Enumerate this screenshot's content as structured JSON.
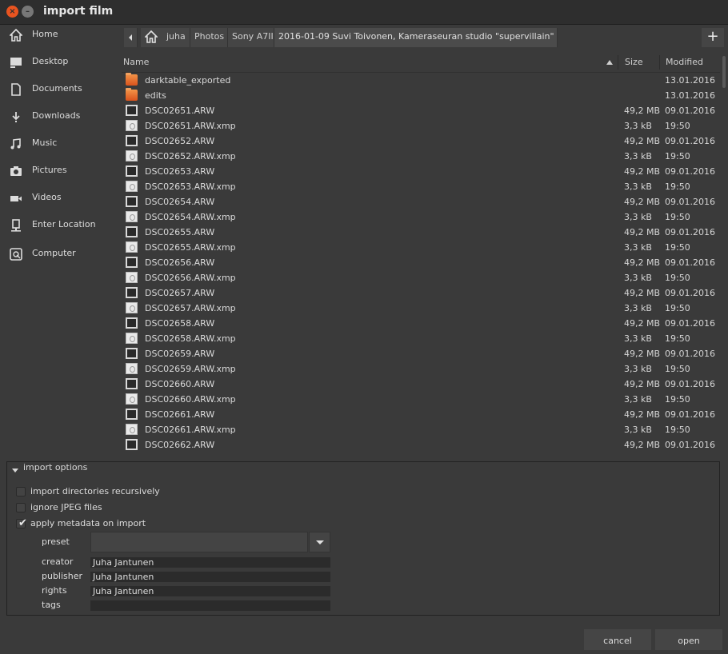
{
  "window": {
    "title": "import film"
  },
  "sidebar": {
    "items": [
      {
        "label": "Home",
        "icon": "home-icon"
      },
      {
        "label": "Desktop",
        "icon": "desktop-icon"
      },
      {
        "label": "Documents",
        "icon": "document-icon"
      },
      {
        "label": "Downloads",
        "icon": "download-icon"
      },
      {
        "label": "Music",
        "icon": "music-icon"
      },
      {
        "label": "Pictures",
        "icon": "camera-icon"
      },
      {
        "label": "Videos",
        "icon": "video-icon"
      },
      {
        "label": "Enter Location",
        "icon": "location-icon"
      },
      {
        "label": "Computer",
        "icon": "computer-icon"
      }
    ]
  },
  "pathbar": {
    "crumbs": [
      "juha",
      "Photos",
      "Sony A7II",
      "2016-01-09 Suvi Toivonen, Kameraseuran studio \"supervillain\""
    ],
    "new_folder_label": "+"
  },
  "filelist": {
    "columns": {
      "name": "Name",
      "size": "Size",
      "modified": "Modified"
    },
    "rows": [
      {
        "name": "darktable_exported",
        "size": "",
        "modified": "13.01.2016",
        "kind": "folder"
      },
      {
        "name": "edits",
        "size": "",
        "modified": "13.01.2016",
        "kind": "folder"
      },
      {
        "name": "DSC02651.ARW",
        "size": "49,2 MB",
        "modified": "09.01.2016",
        "kind": "raw"
      },
      {
        "name": "DSC02651.ARW.xmp",
        "size": "3,3 kB",
        "modified": "19:50",
        "kind": "xmp"
      },
      {
        "name": "DSC02652.ARW",
        "size": "49,2 MB",
        "modified": "09.01.2016",
        "kind": "raw"
      },
      {
        "name": "DSC02652.ARW.xmp",
        "size": "3,3 kB",
        "modified": "19:50",
        "kind": "xmp"
      },
      {
        "name": "DSC02653.ARW",
        "size": "49,2 MB",
        "modified": "09.01.2016",
        "kind": "raw"
      },
      {
        "name": "DSC02653.ARW.xmp",
        "size": "3,3 kB",
        "modified": "19:50",
        "kind": "xmp"
      },
      {
        "name": "DSC02654.ARW",
        "size": "49,2 MB",
        "modified": "09.01.2016",
        "kind": "raw"
      },
      {
        "name": "DSC02654.ARW.xmp",
        "size": "3,3 kB",
        "modified": "19:50",
        "kind": "xmp"
      },
      {
        "name": "DSC02655.ARW",
        "size": "49,2 MB",
        "modified": "09.01.2016",
        "kind": "raw"
      },
      {
        "name": "DSC02655.ARW.xmp",
        "size": "3,3 kB",
        "modified": "19:50",
        "kind": "xmp"
      },
      {
        "name": "DSC02656.ARW",
        "size": "49,2 MB",
        "modified": "09.01.2016",
        "kind": "raw"
      },
      {
        "name": "DSC02656.ARW.xmp",
        "size": "3,3 kB",
        "modified": "19:50",
        "kind": "xmp"
      },
      {
        "name": "DSC02657.ARW",
        "size": "49,2 MB",
        "modified": "09.01.2016",
        "kind": "raw"
      },
      {
        "name": "DSC02657.ARW.xmp",
        "size": "3,3 kB",
        "modified": "19:50",
        "kind": "xmp"
      },
      {
        "name": "DSC02658.ARW",
        "size": "49,2 MB",
        "modified": "09.01.2016",
        "kind": "raw"
      },
      {
        "name": "DSC02658.ARW.xmp",
        "size": "3,3 kB",
        "modified": "19:50",
        "kind": "xmp"
      },
      {
        "name": "DSC02659.ARW",
        "size": "49,2 MB",
        "modified": "09.01.2016",
        "kind": "raw"
      },
      {
        "name": "DSC02659.ARW.xmp",
        "size": "3,3 kB",
        "modified": "19:50",
        "kind": "xmp"
      },
      {
        "name": "DSC02660.ARW",
        "size": "49,2 MB",
        "modified": "09.01.2016",
        "kind": "raw"
      },
      {
        "name": "DSC02660.ARW.xmp",
        "size": "3,3 kB",
        "modified": "19:50",
        "kind": "xmp"
      },
      {
        "name": "DSC02661.ARW",
        "size": "49,2 MB",
        "modified": "09.01.2016",
        "kind": "raw"
      },
      {
        "name": "DSC02661.ARW.xmp",
        "size": "3,3 kB",
        "modified": "19:50",
        "kind": "xmp"
      },
      {
        "name": "DSC02662.ARW",
        "size": "49,2 MB",
        "modified": "09.01.2016",
        "kind": "raw"
      }
    ]
  },
  "import_options": {
    "title": "import options",
    "recursive": {
      "label": "import directories recursively",
      "checked": false
    },
    "ignore_jpeg": {
      "label": "ignore JPEG files",
      "checked": false
    },
    "apply_metadata": {
      "label": "apply metadata on import",
      "checked": true
    },
    "preset_label": "preset",
    "preset_value": "",
    "creator": {
      "label": "creator",
      "value": "Juha Jantunen"
    },
    "publisher": {
      "label": "publisher",
      "value": "Juha Jantunen"
    },
    "rights": {
      "label": "rights",
      "value": "Juha Jantunen"
    },
    "tags": {
      "label": "tags",
      "value": ""
    }
  },
  "buttons": {
    "cancel": "cancel",
    "open": "open"
  },
  "colors": {
    "accent_close": "#e95420",
    "folder": "#e8702a",
    "background": "#3a3a3a"
  }
}
